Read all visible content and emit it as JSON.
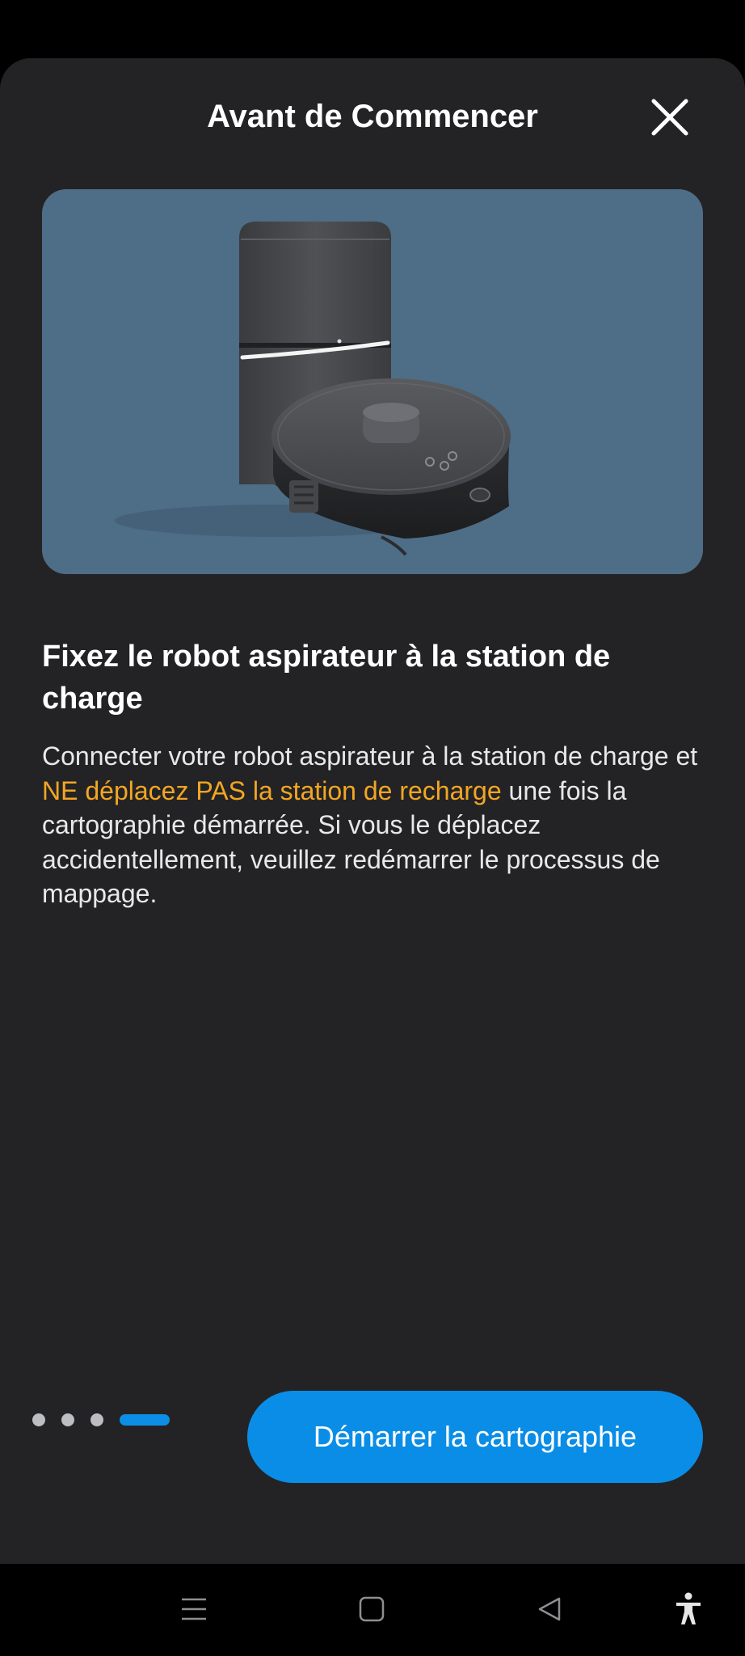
{
  "dialog": {
    "title": "Avant de Commencer",
    "close_icon": "close-icon"
  },
  "illustration": {
    "subject": "robot-vacuum-with-charging-station",
    "background_color": "#4e6d87"
  },
  "step": {
    "title": "Fixez le robot aspirateur à la station de charge",
    "description_before": "Connecter votre robot aspirateur à la station de charge et ",
    "description_highlight": "NE déplacez PAS la station de recharge",
    "description_after": " une fois la cartographie démarrée. Si vous le déplacez accidentellement, veuillez redémarrer le processus de mappage.",
    "highlight_color": "#f3a623"
  },
  "pagination": {
    "total": 4,
    "current": 4
  },
  "actions": {
    "start_mapping_label": "Démarrer la cartographie",
    "button_color": "#0a8de6"
  },
  "system_nav": {
    "icons": [
      "menu-icon",
      "home-icon",
      "back-icon",
      "accessibility-icon"
    ]
  }
}
